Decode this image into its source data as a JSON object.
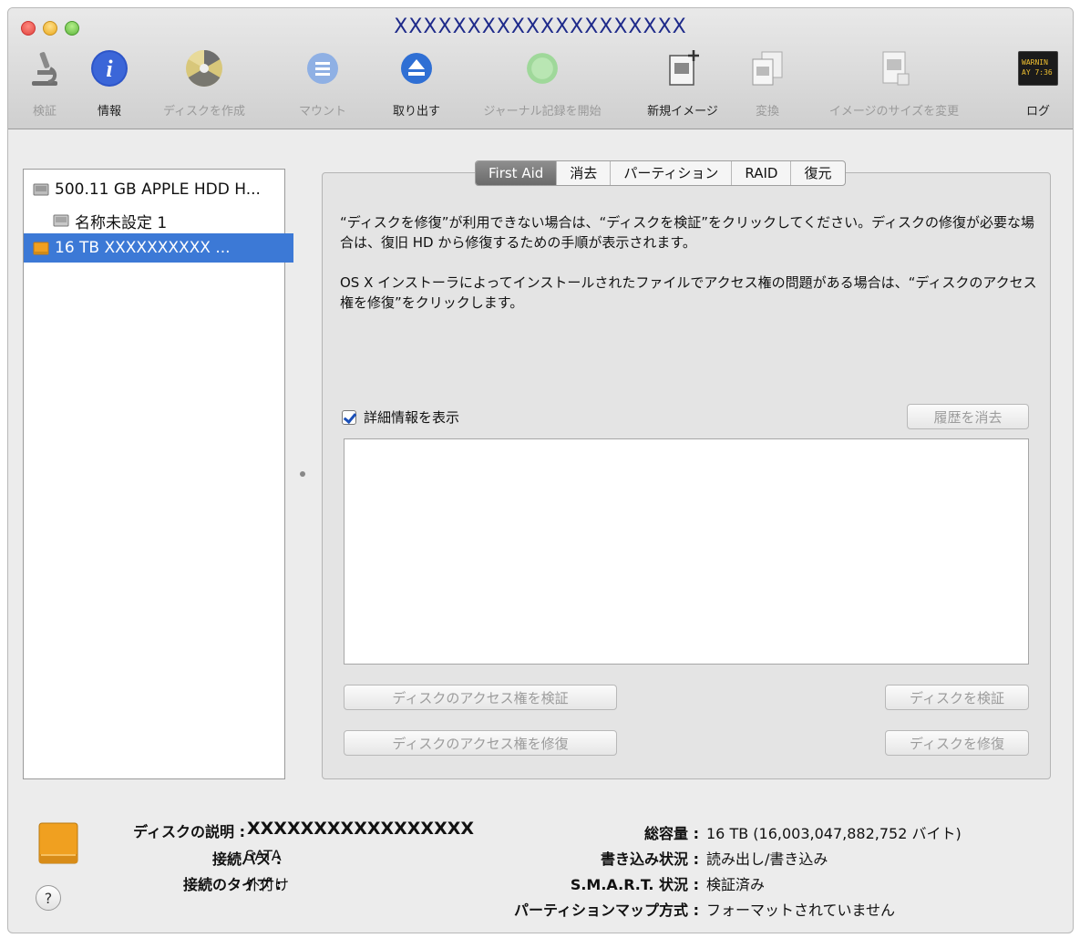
{
  "window": {
    "title": "XXXXXXXXXXXXXXXXXXXX"
  },
  "toolbar": {
    "items": [
      {
        "label": "検証",
        "icon": "microscope-icon",
        "enabled": false
      },
      {
        "label": "情報",
        "icon": "info-icon",
        "enabled": true
      },
      {
        "label": "ディスクを作成",
        "icon": "burn-icon",
        "enabled": false
      },
      {
        "label": "マウント",
        "icon": "mount-icon",
        "enabled": false
      },
      {
        "label": "取り出す",
        "icon": "eject-icon",
        "enabled": true
      },
      {
        "label": "ジャーナル記録を開始",
        "icon": "journal-icon",
        "enabled": false
      },
      {
        "label": "新規イメージ",
        "icon": "new-image-icon",
        "enabled": true
      },
      {
        "label": "変換",
        "icon": "convert-icon",
        "enabled": false
      },
      {
        "label": "イメージのサイズを変更",
        "icon": "resize-image-icon",
        "enabled": false
      },
      {
        "label": "ログ",
        "icon": "log-icon",
        "enabled": true
      }
    ],
    "log_icon_text": [
      "WARNIN",
      "AY 7:36"
    ]
  },
  "sidebar": {
    "disks": [
      {
        "label": "500.11 GB APPLE HDD H...",
        "level": 0,
        "selected": false
      },
      {
        "label": "名称未設定 1",
        "level": 1,
        "selected": false
      },
      {
        "label": "16 TB XXXXXXXXXX ...",
        "level": 0,
        "selected": true
      }
    ]
  },
  "tabs": [
    {
      "label": "First Aid",
      "active": true
    },
    {
      "label": "消去",
      "active": false
    },
    {
      "label": "パーティション",
      "active": false
    },
    {
      "label": "RAID",
      "active": false
    },
    {
      "label": "復元",
      "active": false
    }
  ],
  "first_aid": {
    "paragraph1": "“ディスクを修復”が利用できない場合は、“ディスクを検証”をクリックしてください。ディスクの修復が必要な場合は、復旧 HD から修復するための手順が表示されます。",
    "paragraph2": "OS X インストーラによってインストールされたファイルでアクセス権の問題がある場合は、“ディスクのアクセス権を修復”をクリックします。",
    "show_details_label": "詳細情報を表示",
    "show_details_checked": true,
    "clear_history_label": "履歴を消去",
    "verify_permissions_label": "ディスクのアクセス権を検証",
    "repair_permissions_label": "ディスクのアクセス権を修復",
    "verify_disk_label": "ディスクを検証",
    "repair_disk_label": "ディスクを修復"
  },
  "info": {
    "description_label": "ディスクの説明 :",
    "description_value": "XXXXXXXXXXXXXXXXX",
    "bus_label": "接続バス :",
    "bus_value": "SATA",
    "connection_type_label": "接続のタイプ :",
    "connection_type_value": "外付け",
    "capacity_label": "総容量 :",
    "capacity_value": "16 TB (16,003,047,882,752 バイト)",
    "write_status_label": "書き込み状況 :",
    "write_status_value": "読み出し/書き込み",
    "smart_label": "S.M.A.R.T. 状況 :",
    "smart_value": "検証済み",
    "partition_map_label": "パーティションマップ方式 :",
    "partition_map_value": "フォーマットされていません"
  },
  "help_symbol": "?",
  "colors": {
    "selection": "#3c79d6",
    "title": "#1e2a8a",
    "disk_orange": "#f0a020"
  }
}
